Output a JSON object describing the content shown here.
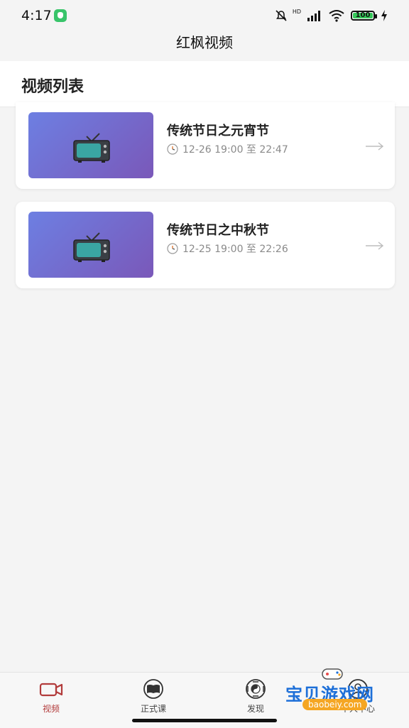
{
  "status_bar": {
    "time": "4:17",
    "network": "HD",
    "battery": "100"
  },
  "app": {
    "title": "红枫视频"
  },
  "section": {
    "title": "视频列表"
  },
  "videos": [
    {
      "title": "传统节日之元宵节",
      "time": "12-26 19:00 至 22:47"
    },
    {
      "title": "传统节日之中秋节",
      "time": "12-25 19:00 至 22:26"
    }
  ],
  "tabs": [
    {
      "label": "视频",
      "icon": "video-camera-icon",
      "active": true
    },
    {
      "label": "正式课",
      "icon": "book-icon",
      "active": false
    },
    {
      "label": "发现",
      "icon": "bagua-icon",
      "active": false
    },
    {
      "label": "个人中心",
      "icon": "user-icon",
      "active": false
    }
  ],
  "watermark": {
    "name": "宝贝游戏网",
    "url": "baobeiy.com"
  },
  "colors": {
    "accent": "#b23b3b",
    "thumbnail_start": "#6d7fe2",
    "thumbnail_end": "#7a58b9"
  }
}
